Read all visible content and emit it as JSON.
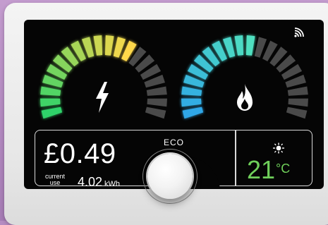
{
  "display": {
    "cost": "£0.49",
    "current_use_label_1": "current",
    "current_use_label_2": "use",
    "usage_value": "4.02",
    "usage_unit": "kWh",
    "mode_label": "ECO",
    "temperature": "21",
    "temperature_unit": "°C"
  },
  "electricity_gauge": {
    "lit_fraction": 0.66,
    "icon": "lightning-bolt-icon"
  },
  "gas_gauge": {
    "lit_fraction": 0.55,
    "icon": "flame-icon"
  },
  "status": {
    "signal_icon": "signal-icon",
    "weather_icon": "sun-moon-icon"
  },
  "colors": {
    "electric_low": "#2fd36a",
    "electric_high": "#ffd84a",
    "gas_low": "#2fa7e8",
    "gas_high": "#4fe0c0",
    "unlit": "#4a4a4a",
    "temperature": "#6fcf5a"
  }
}
